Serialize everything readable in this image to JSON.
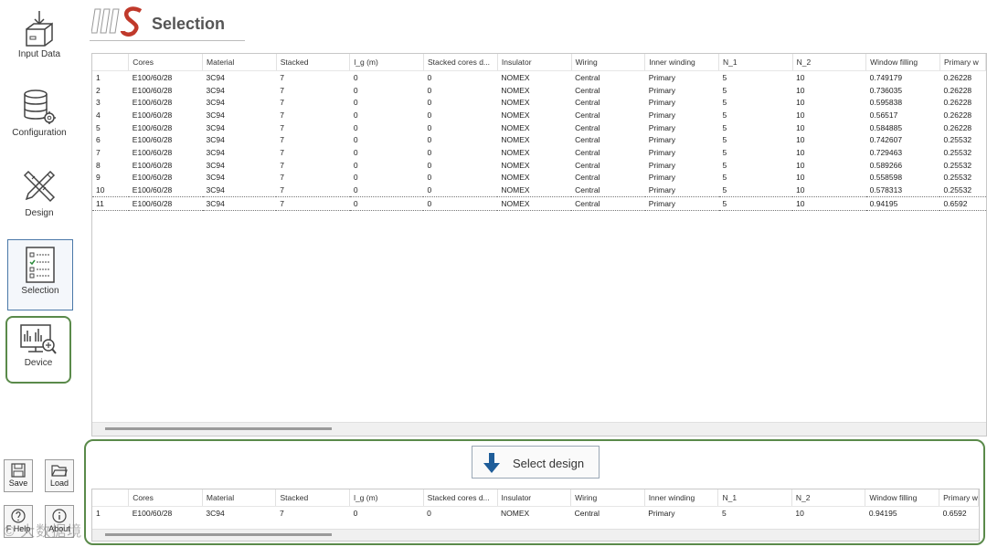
{
  "sidebar": {
    "input_data": "Input Data",
    "configuration": "Configuration",
    "design": "Design",
    "selection": "Selection",
    "device": "Device"
  },
  "bottom_buttons": {
    "save": "Save",
    "load": "Load",
    "help": "F Help",
    "about": "About"
  },
  "watermark": "© 大数据境",
  "header": {
    "title": "Selection"
  },
  "columns": [
    "",
    "Cores",
    "Material",
    "Stacked",
    "l_g (m)",
    "Stacked cores d...",
    "Insulator",
    "Wiring",
    "Inner winding",
    "N_1",
    "N_2",
    "Window filling",
    "Primary w"
  ],
  "rows": [
    [
      "1",
      "E100/60/28",
      "3C94",
      "7",
      "0",
      "0",
      "NOMEX",
      "Central",
      "Primary",
      "5",
      "10",
      "0.749179",
      "0.26228"
    ],
    [
      "2",
      "E100/60/28",
      "3C94",
      "7",
      "0",
      "0",
      "NOMEX",
      "Central",
      "Primary",
      "5",
      "10",
      "0.736035",
      "0.26228"
    ],
    [
      "3",
      "E100/60/28",
      "3C94",
      "7",
      "0",
      "0",
      "NOMEX",
      "Central",
      "Primary",
      "5",
      "10",
      "0.595838",
      "0.26228"
    ],
    [
      "4",
      "E100/60/28",
      "3C94",
      "7",
      "0",
      "0",
      "NOMEX",
      "Central",
      "Primary",
      "5",
      "10",
      "0.56517",
      "0.26228"
    ],
    [
      "5",
      "E100/60/28",
      "3C94",
      "7",
      "0",
      "0",
      "NOMEX",
      "Central",
      "Primary",
      "5",
      "10",
      "0.584885",
      "0.26228"
    ],
    [
      "6",
      "E100/60/28",
      "3C94",
      "7",
      "0",
      "0",
      "NOMEX",
      "Central",
      "Primary",
      "5",
      "10",
      "0.742607",
      "0.25532"
    ],
    [
      "7",
      "E100/60/28",
      "3C94",
      "7",
      "0",
      "0",
      "NOMEX",
      "Central",
      "Primary",
      "5",
      "10",
      "0.729463",
      "0.25532"
    ],
    [
      "8",
      "E100/60/28",
      "3C94",
      "7",
      "0",
      "0",
      "NOMEX",
      "Central",
      "Primary",
      "5",
      "10",
      "0.589266",
      "0.25532"
    ],
    [
      "9",
      "E100/60/28",
      "3C94",
      "7",
      "0",
      "0",
      "NOMEX",
      "Central",
      "Primary",
      "5",
      "10",
      "0.558598",
      "0.25532"
    ],
    [
      "10",
      "E100/60/28",
      "3C94",
      "7",
      "0",
      "0",
      "NOMEX",
      "Central",
      "Primary",
      "5",
      "10",
      "0.578313",
      "0.25532"
    ],
    [
      "11",
      "E100/60/28",
      "3C94",
      "7",
      "0",
      "0",
      "NOMEX",
      "Central",
      "Primary",
      "5",
      "10",
      "0.94195",
      "0.6592"
    ]
  ],
  "selected_row_index": 10,
  "select_button": {
    "label": "Select design"
  },
  "selected_rows": [
    [
      "1",
      "E100/60/28",
      "3C94",
      "7",
      "0",
      "0",
      "NOMEX",
      "Central",
      "Primary",
      "5",
      "10",
      "0.94195",
      "0.6592"
    ]
  ],
  "colors": {
    "highlight_border": "#5a8a4a",
    "selected_nav_border": "#4a78a8",
    "select_arrow": "#1f5d99",
    "logo_red": "#c0392b"
  }
}
